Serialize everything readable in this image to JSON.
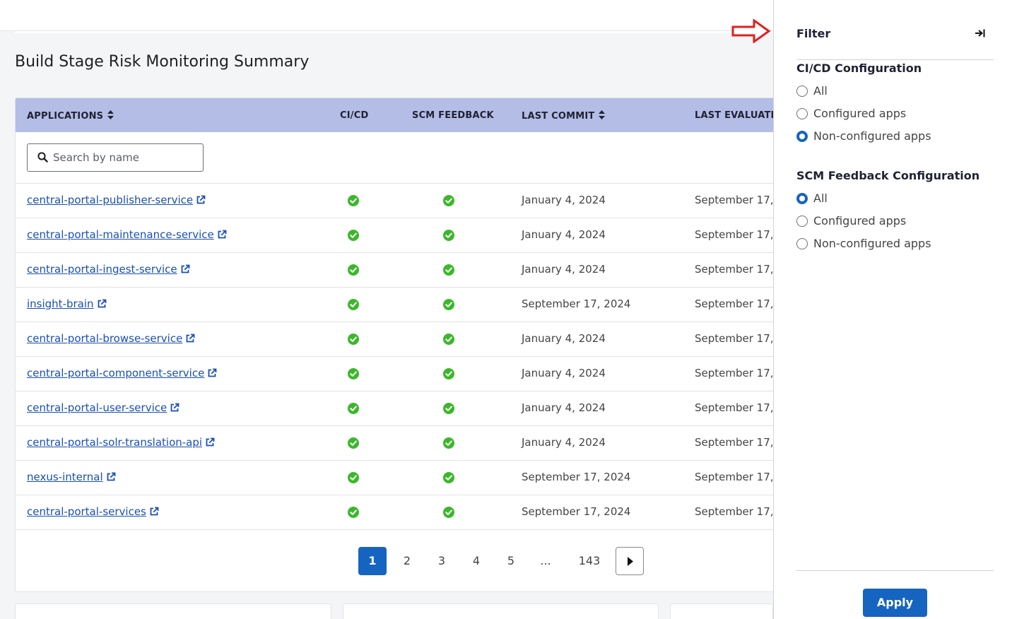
{
  "summary": {
    "title": "Build Stage Risk Monitoring Summary"
  },
  "table": {
    "headers": {
      "applications": "APPLICATIONS",
      "cicd": "CI/CD",
      "scm_feedback": "SCM FEEDBACK",
      "last_commit": "LAST COMMIT",
      "last_evaluation": "LAST EVALUATIC"
    },
    "search": {
      "placeholder": "Search by name"
    },
    "rows": [
      {
        "app": "central-portal-publisher-service",
        "cicd": true,
        "scm": true,
        "last_commit": "January 4, 2024",
        "last_evaluation": "September 17,"
      },
      {
        "app": "central-portal-maintenance-service",
        "cicd": true,
        "scm": true,
        "last_commit": "January 4, 2024",
        "last_evaluation": "September 17,"
      },
      {
        "app": "central-portal-ingest-service",
        "cicd": true,
        "scm": true,
        "last_commit": "January 4, 2024",
        "last_evaluation": "September 17,"
      },
      {
        "app": "insight-brain",
        "cicd": true,
        "scm": true,
        "last_commit": "September 17, 2024",
        "last_evaluation": "September 17,"
      },
      {
        "app": "central-portal-browse-service",
        "cicd": true,
        "scm": true,
        "last_commit": "January 4, 2024",
        "last_evaluation": "September 17,"
      },
      {
        "app": "central-portal-component-service",
        "cicd": true,
        "scm": true,
        "last_commit": "January 4, 2024",
        "last_evaluation": "September 17,"
      },
      {
        "app": "central-portal-user-service",
        "cicd": true,
        "scm": true,
        "last_commit": "January 4, 2024",
        "last_evaluation": "September 17,"
      },
      {
        "app": "central-portal-solr-translation-api",
        "cicd": true,
        "scm": true,
        "last_commit": "January 4, 2024",
        "last_evaluation": "September 17,"
      },
      {
        "app": "nexus-internal",
        "cicd": true,
        "scm": true,
        "last_commit": "September 17, 2024",
        "last_evaluation": "September 17,"
      },
      {
        "app": "central-portal-services",
        "cicd": true,
        "scm": true,
        "last_commit": "September 17, 2024",
        "last_evaluation": "September 17,"
      }
    ]
  },
  "pagination": {
    "pages": [
      "1",
      "2",
      "3",
      "4",
      "5",
      "...",
      "143"
    ],
    "current": "1"
  },
  "filter": {
    "title": "Filter",
    "sections": [
      {
        "title": "CI/CD Configuration",
        "options": [
          "All",
          "Configured apps",
          "Non-configured apps"
        ],
        "selected": "Non-configured apps"
      },
      {
        "title": "SCM Feedback Configuration",
        "options": [
          "All",
          "Configured apps",
          "Non-configured apps"
        ],
        "selected": "All"
      }
    ],
    "apply_label": "Apply"
  },
  "icons": {
    "sort": "sort-icon",
    "external_link": "external-link-icon",
    "check": "check-circle-icon",
    "search": "search-icon",
    "collapse": "collapse-panel-icon",
    "next": "caret-right-icon",
    "annotation_arrow": "red-arrow-icon"
  },
  "colors": {
    "header_bg": "#b4bde6",
    "link": "#1a4fb5",
    "check": "#3bb82a",
    "primary": "#1565c0",
    "annotation": "#e02020"
  }
}
